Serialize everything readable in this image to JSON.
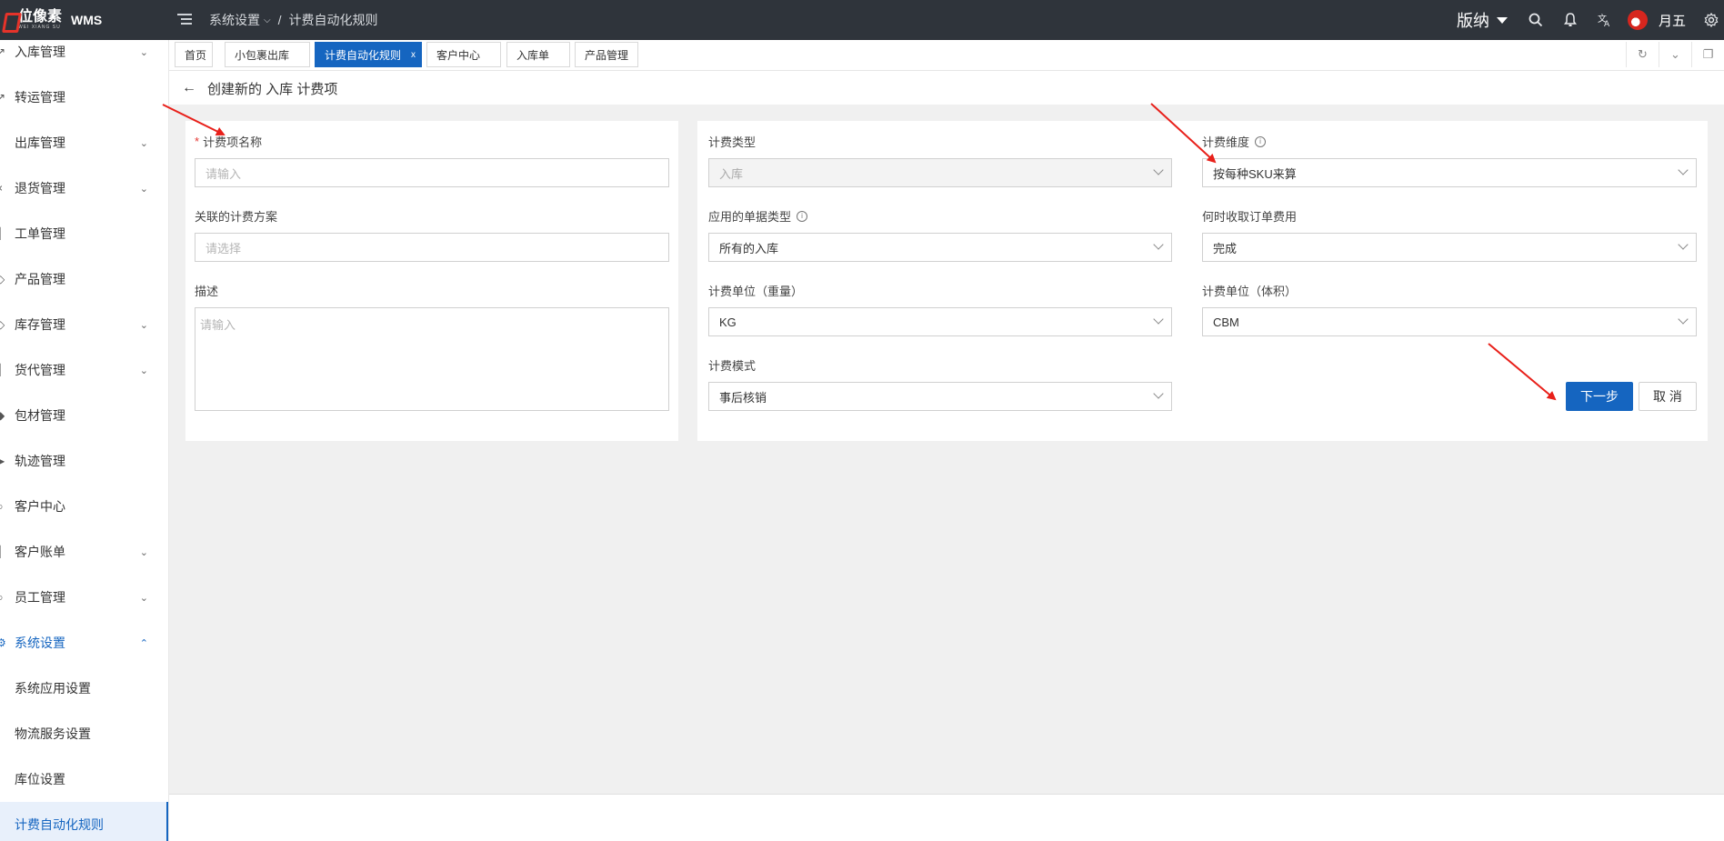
{
  "app": {
    "logo_text": "位像素",
    "logo_sub": "WEI XIANG SU",
    "product": "WMS"
  },
  "breadcrumb": {
    "parent": "系统设置",
    "current": "计费自动化规则"
  },
  "header_right": {
    "warehouse": "版纳",
    "user_name": "月五"
  },
  "sidebar": {
    "items": [
      {
        "label": "入库管理",
        "icon": "inbound-icon",
        "has_children": true
      },
      {
        "label": "转运管理",
        "icon": "transfer-icon",
        "has_children": false
      },
      {
        "label": "出库管理",
        "icon": "outbound-icon",
        "has_children": true
      },
      {
        "label": "退货管理",
        "icon": "return-icon",
        "has_children": true
      },
      {
        "label": "工单管理",
        "icon": "workorder-icon",
        "has_children": false
      },
      {
        "label": "产品管理",
        "icon": "product-icon",
        "has_children": false
      },
      {
        "label": "库存管理",
        "icon": "stock-icon",
        "has_children": true
      },
      {
        "label": "货代管理",
        "icon": "forwarder-icon",
        "has_children": true
      },
      {
        "label": "包材管理",
        "icon": "packaging-icon",
        "has_children": false
      },
      {
        "label": "轨迹管理",
        "icon": "track-icon",
        "has_children": false
      },
      {
        "label": "客户中心",
        "icon": "customer-icon",
        "has_children": false
      },
      {
        "label": "客户账单",
        "icon": "bill-icon",
        "has_children": true
      },
      {
        "label": "员工管理",
        "icon": "staff-icon",
        "has_children": true
      },
      {
        "label": "系统设置",
        "icon": "settings-icon",
        "has_children": true,
        "expanded": true
      }
    ],
    "sub_items": [
      {
        "label": "系统应用设置"
      },
      {
        "label": "物流服务设置"
      },
      {
        "label": "库位设置"
      },
      {
        "label": "计费自动化规则",
        "current": true
      }
    ]
  },
  "tabs": [
    {
      "label": "首页"
    },
    {
      "label": "小包裹出库"
    },
    {
      "label": "计费自动化规则",
      "active": true,
      "close": "x"
    },
    {
      "label": "客户中心"
    },
    {
      "label": "入库单"
    },
    {
      "label": "产品管理"
    }
  ],
  "page": {
    "title": "创建新的 入库 计费项"
  },
  "form": {
    "name": {
      "label": "计费项名称",
      "required_mark": "*",
      "placeholder": "请输入"
    },
    "plan": {
      "label": "关联的计费方案",
      "placeholder": "请选择"
    },
    "description": {
      "label": "描述",
      "placeholder": "请输入"
    },
    "fee_type": {
      "label": "计费类型",
      "value": "入库"
    },
    "doc_type": {
      "label": "应用的单据类型",
      "value": "所有的入库"
    },
    "weight_unit": {
      "label": "计费单位（重量）",
      "value": "KG"
    },
    "mode": {
      "label": "计费模式",
      "value": "事后核销"
    },
    "dimension": {
      "label": "计费维度",
      "value": "按每种SKU来算"
    },
    "charge_time": {
      "label": "何时收取订单费用",
      "value": "完成"
    },
    "volume_unit": {
      "label": "计费单位（体积）",
      "value": "CBM"
    }
  },
  "buttons": {
    "next": "下一步",
    "cancel": "取 消"
  },
  "colors": {
    "header_bg": "#2f343b",
    "accent": "#1565c0",
    "annotation_arrow": "#e8201a"
  }
}
